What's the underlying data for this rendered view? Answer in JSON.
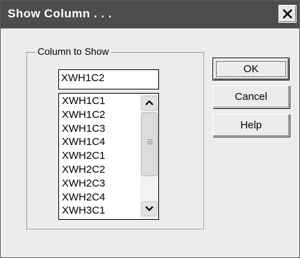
{
  "window": {
    "title": "Show Column . . ."
  },
  "group": {
    "label": "Column to Show"
  },
  "input": {
    "value": "XWH1C2"
  },
  "list": {
    "items": [
      "XWH1C1",
      "XWH1C2",
      "XWH1C3",
      "XWH1C4",
      "XWH2C1",
      "XWH2C2",
      "XWH2C3",
      "XWH2C4",
      "XWH3C1"
    ]
  },
  "buttons": {
    "ok": "OK",
    "cancel": "Cancel",
    "help": "Help"
  },
  "icons": {
    "close": "close-icon",
    "scroll_up": "chevron-up-icon",
    "scroll_down": "chevron-down-icon"
  },
  "colors": {
    "titlebar": "#4d4d4d",
    "dialog_bg": "#ececec"
  }
}
